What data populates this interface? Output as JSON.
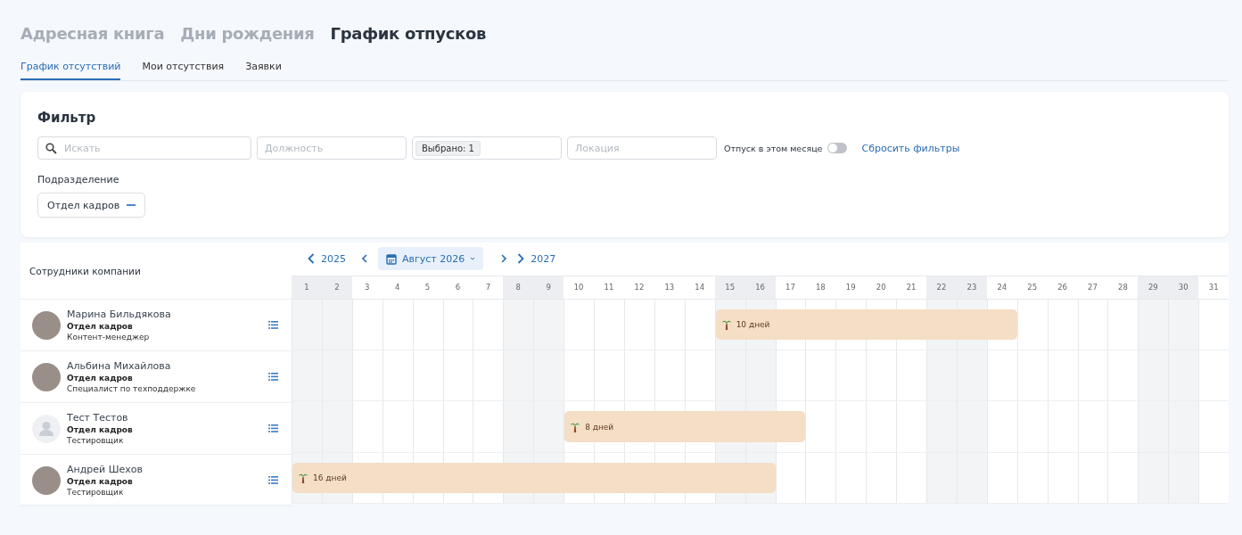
{
  "section_tabs": [
    {
      "label": "Адресная книга",
      "selected": false
    },
    {
      "label": "Дни рождения",
      "selected": false
    },
    {
      "label": "График отпусков",
      "selected": true
    }
  ],
  "sub_tabs": [
    {
      "label": "График отсутствий",
      "selected": true
    },
    {
      "label": "Мои отсутствия",
      "selected": false
    },
    {
      "label": "Заявки",
      "selected": false
    }
  ],
  "filter": {
    "title": "Фильтр",
    "search": {
      "placeholder": "Искать"
    },
    "position": {
      "placeholder": "Должность"
    },
    "selected_chip": "Выбрано: 1",
    "location": {
      "placeholder": "Локация"
    },
    "vacation_toggle": {
      "label": "Отпуск в этом месяце",
      "on": false
    },
    "reset_link": "Сбросить фильтры",
    "department_label": "Подразделение",
    "department_chip": "Отдел кадров"
  },
  "calendar": {
    "employees_header": "Сотрудники компании",
    "prev_year": "2025",
    "month": "Август 2026",
    "next_year": "2027",
    "days": [
      {
        "label": "1",
        "weekend": true
      },
      {
        "label": "2",
        "weekend": true
      },
      {
        "label": "3",
        "weekend": false
      },
      {
        "label": "4",
        "weekend": false
      },
      {
        "label": "5",
        "weekend": false
      },
      {
        "label": "6",
        "weekend": false
      },
      {
        "label": "7",
        "weekend": false
      },
      {
        "label": "8",
        "weekend": true
      },
      {
        "label": "9",
        "weekend": true
      },
      {
        "label": "10",
        "weekend": false
      },
      {
        "label": "11",
        "weekend": false
      },
      {
        "label": "12",
        "weekend": false
      },
      {
        "label": "13",
        "weekend": false
      },
      {
        "label": "14",
        "weekend": false
      },
      {
        "label": "15",
        "weekend": true
      },
      {
        "label": "16",
        "weekend": true
      },
      {
        "label": "17",
        "weekend": false
      },
      {
        "label": "18",
        "weekend": false
      },
      {
        "label": "19",
        "weekend": false
      },
      {
        "label": "20",
        "weekend": false
      },
      {
        "label": "21",
        "weekend": false
      },
      {
        "label": "22",
        "weekend": true
      },
      {
        "label": "23",
        "weekend": true
      },
      {
        "label": "24",
        "weekend": false
      },
      {
        "label": "25",
        "weekend": false
      },
      {
        "label": "26",
        "weekend": false
      },
      {
        "label": "27",
        "weekend": false
      },
      {
        "label": "28",
        "weekend": false
      },
      {
        "label": "29",
        "weekend": true
      },
      {
        "label": "30",
        "weekend": true
      },
      {
        "label": "31",
        "weekend": false
      }
    ],
    "employees": [
      {
        "name": "Марина Бильдякова",
        "department": "Отдел кадров",
        "position": "Контент-менеджер",
        "kind": "photo",
        "vacation_label": "10 дней",
        "days": [
          {
            "vacation": false
          },
          {
            "vacation": false
          },
          {
            "vacation": false
          },
          {
            "vacation": false
          },
          {
            "vacation": false
          },
          {
            "vacation": false
          },
          {
            "vacation": false
          },
          {
            "vacation": false
          },
          {
            "vacation": false
          },
          {
            "vacation": false
          },
          {
            "vacation": false
          },
          {
            "vacation": false
          },
          {
            "vacation": false
          },
          {
            "vacation": false
          },
          {
            "vacation": true
          },
          {
            "vacation": true
          },
          {
            "vacation": true
          },
          {
            "vacation": true
          },
          {
            "vacation": true
          },
          {
            "vacation": true
          },
          {
            "vacation": true
          },
          {
            "vacation": true
          },
          {
            "vacation": true
          },
          {
            "vacation": true
          },
          {
            "vacation": false
          },
          {
            "vacation": false
          },
          {
            "vacation": false
          },
          {
            "vacation": false
          },
          {
            "vacation": false
          },
          {
            "vacation": false
          },
          {
            "vacation": false
          }
        ]
      },
      {
        "name": "Альбина Михайлова",
        "department": "Отдел кадров",
        "position": "Специалист по техподдержке",
        "kind": "photo",
        "days": [
          {
            "vacation": false
          },
          {
            "vacation": false
          },
          {
            "vacation": false
          },
          {
            "vacation": false
          },
          {
            "vacation": false
          },
          {
            "vacation": false
          },
          {
            "vacation": false
          },
          {
            "vacation": false
          },
          {
            "vacation": false
          },
          {
            "vacation": false
          },
          {
            "vacation": false
          },
          {
            "vacation": false
          },
          {
            "vacation": false
          },
          {
            "vacation": false
          },
          {
            "vacation": false
          },
          {
            "vacation": false
          },
          {
            "vacation": false
          },
          {
            "vacation": false
          },
          {
            "vacation": false
          },
          {
            "vacation": false
          },
          {
            "vacation": false
          },
          {
            "vacation": false
          },
          {
            "vacation": false
          },
          {
            "vacation": false
          },
          {
            "vacation": false
          },
          {
            "vacation": false
          },
          {
            "vacation": false
          },
          {
            "vacation": false
          },
          {
            "vacation": false
          },
          {
            "vacation": false
          },
          {
            "vacation": false
          }
        ]
      },
      {
        "name": "Тест Тестов",
        "department": "Отдел кадров",
        "position": "Тестировщик",
        "kind": "placeholder",
        "vacation_label": "8 дней",
        "days": [
          {
            "vacation": false
          },
          {
            "vacation": false
          },
          {
            "vacation": false
          },
          {
            "vacation": false
          },
          {
            "vacation": false
          },
          {
            "vacation": false
          },
          {
            "vacation": false
          },
          {
            "vacation": false
          },
          {
            "vacation": false
          },
          {
            "vacation": true
          },
          {
            "vacation": true
          },
          {
            "vacation": true
          },
          {
            "vacation": true
          },
          {
            "vacation": true
          },
          {
            "vacation": true
          },
          {
            "vacation": true
          },
          {
            "vacation": true
          },
          {
            "vacation": false
          },
          {
            "vacation": false
          },
          {
            "vacation": false
          },
          {
            "vacation": false
          },
          {
            "vacation": false
          },
          {
            "vacation": false
          },
          {
            "vacation": false
          },
          {
            "vacation": false
          },
          {
            "vacation": false
          },
          {
            "vacation": false
          },
          {
            "vacation": false
          },
          {
            "vacation": false
          },
          {
            "vacation": false
          },
          {
            "vacation": false
          }
        ]
      },
      {
        "name": "Андрей Шехов",
        "department": "Отдел кадров",
        "position": "Тестировщик",
        "kind": "photo",
        "vacation_label": "16 дней",
        "days": [
          {
            "vacation": true
          },
          {
            "vacation": true
          },
          {
            "vacation": true
          },
          {
            "vacation": true
          },
          {
            "vacation": true
          },
          {
            "vacation": true
          },
          {
            "vacation": true
          },
          {
            "vacation": true
          },
          {
            "vacation": true
          },
          {
            "vacation": true
          },
          {
            "vacation": true
          },
          {
            "vacation": true
          },
          {
            "vacation": true
          },
          {
            "vacation": true
          },
          {
            "vacation": true
          },
          {
            "vacation": true
          },
          {
            "vacation": false
          },
          {
            "vacation": false
          },
          {
            "vacation": false
          },
          {
            "vacation": false
          },
          {
            "vacation": false
          },
          {
            "vacation": false
          },
          {
            "vacation": false
          },
          {
            "vacation": false
          },
          {
            "vacation": false
          },
          {
            "vacation": false
          },
          {
            "vacation": false
          },
          {
            "vacation": false
          },
          {
            "vacation": false
          },
          {
            "vacation": false
          },
          {
            "vacation": false
          }
        ]
      }
    ]
  }
}
